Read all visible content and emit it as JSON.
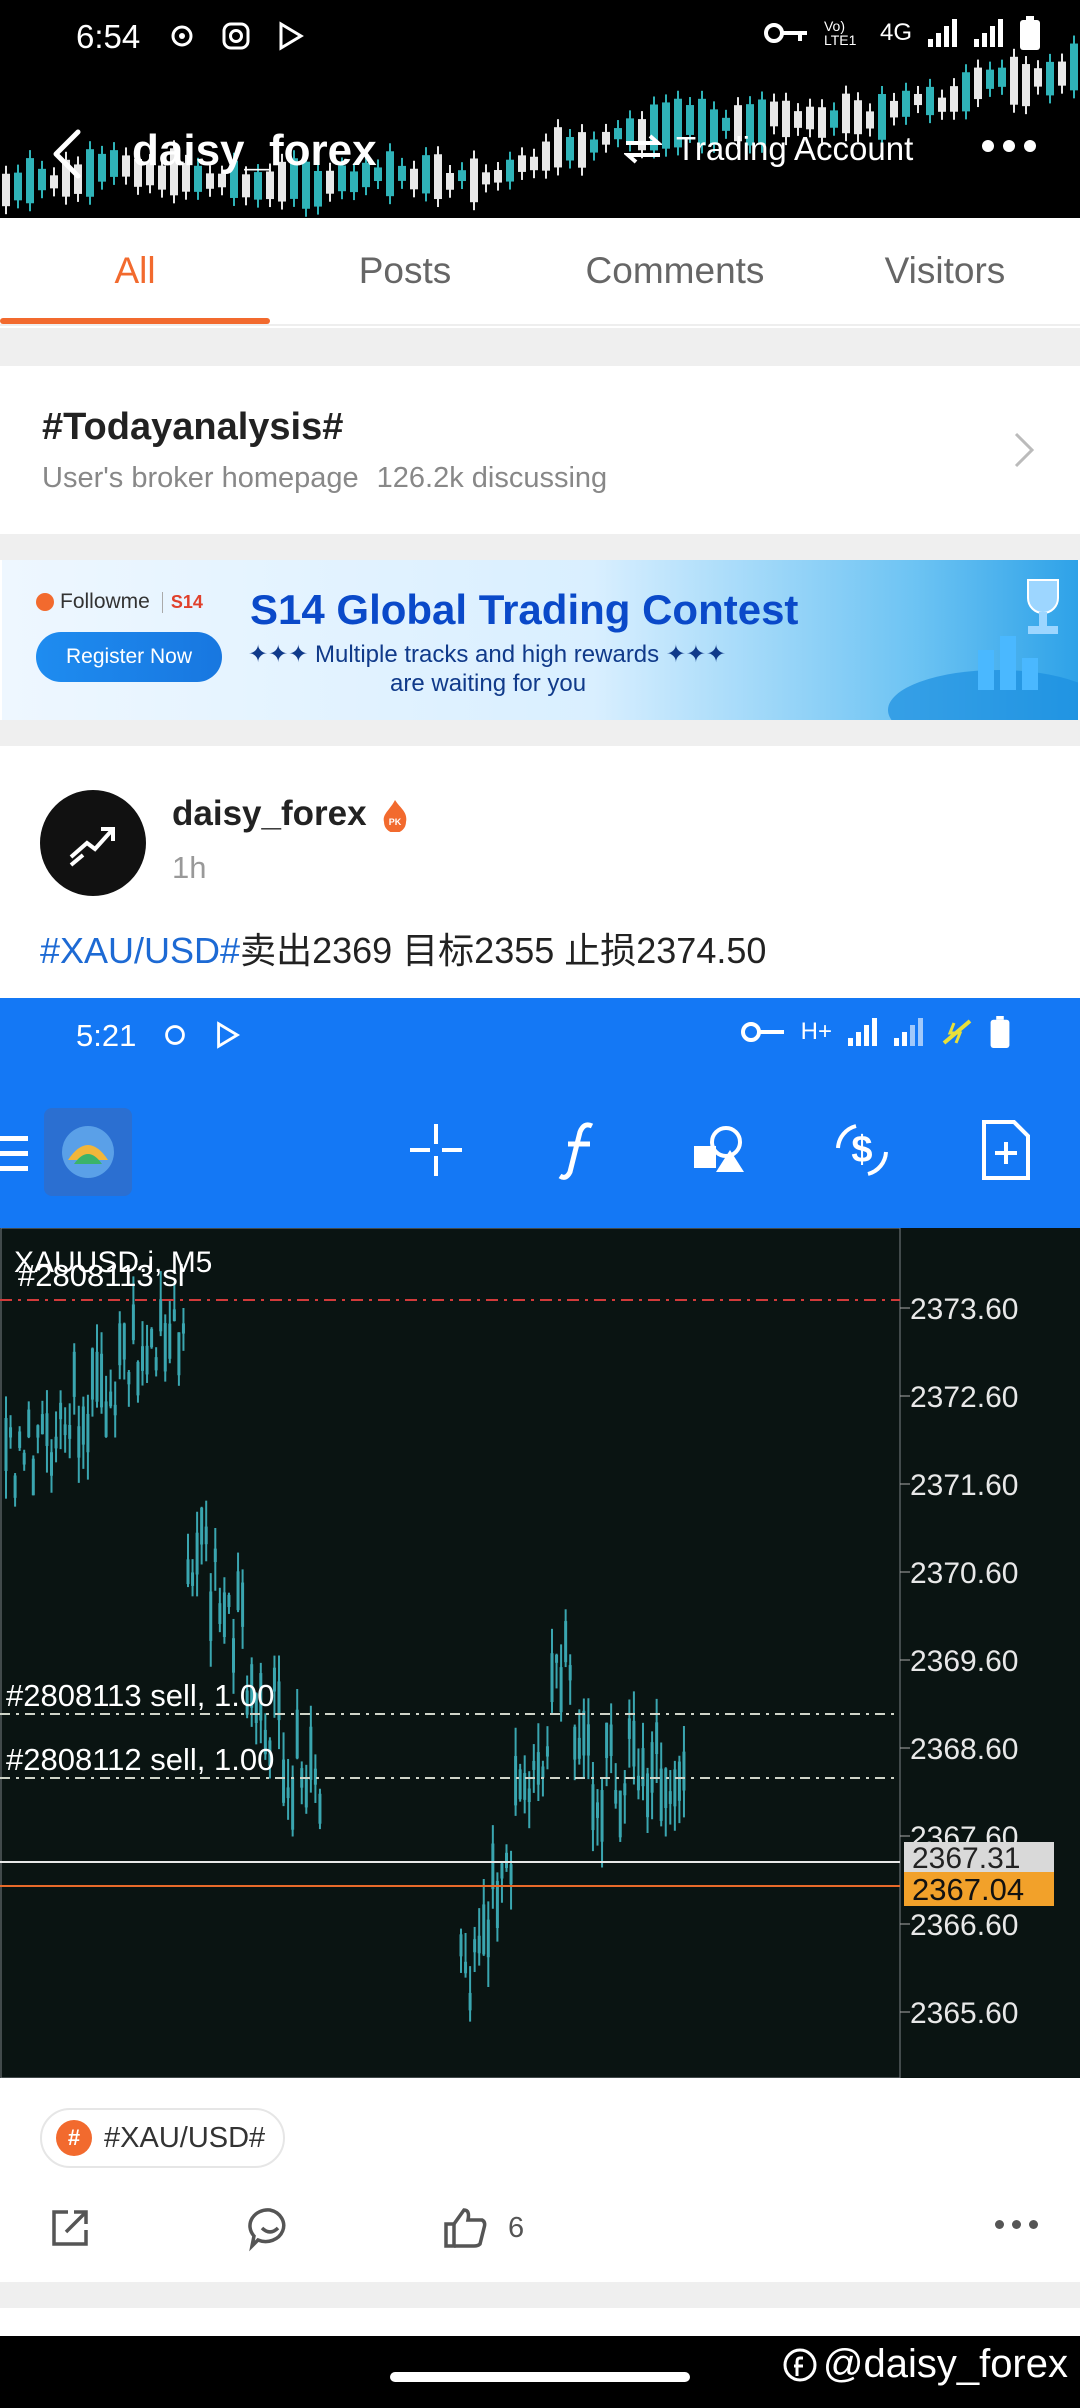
{
  "status_bar": {
    "time": "6:54",
    "network": "4G",
    "lte_label": "Vo) LTE1"
  },
  "nav": {
    "title": "daisy_forex",
    "account_label": "Trading Account"
  },
  "tabs": [
    {
      "label": "All",
      "active": true
    },
    {
      "label": "Posts",
      "active": false
    },
    {
      "label": "Comments",
      "active": false
    },
    {
      "label": "Visitors",
      "active": false
    }
  ],
  "topic": {
    "title": "#Todayanalysis#",
    "subtitle": "User's broker homepage",
    "discussing": "126.2k discussing"
  },
  "banner": {
    "brand": "Followme",
    "brand_tag": "S14",
    "register_label": "Register Now",
    "title": "S14 Global Trading Contest",
    "line1": "Multiple tracks and high rewards",
    "line2": "are waiting for you"
  },
  "post": {
    "author": "daisy_forex",
    "badge": "PK",
    "time": "1h",
    "text_tag": "#XAU/USD#",
    "text_body": "卖出2369 目标2355 止损2374.50",
    "topic_tag": "#XAU/USD#",
    "like_count": "6"
  },
  "embedded": {
    "status_time": "5:21",
    "network": "H+",
    "chart_symbol": "XAUUSD.i, M5",
    "order_sl_label": "#2808113 sl",
    "order1_label": "#2808113 sell, 1.00",
    "order2_label": "#2808112 sell, 1.00",
    "price_labels": [
      "2373.60",
      "2372.60",
      "2371.60",
      "2370.60",
      "2369.60",
      "2368.60",
      "2367.60",
      "2366.60",
      "2365.60"
    ],
    "current_bid": "2367.31",
    "current_price": "2367.04"
  },
  "watermark": "@daisy_forex",
  "colors": {
    "accent": "#f26a2e",
    "link": "#1d6ad4",
    "mt_blue": "#1478f5",
    "candle": "#3aa6b0"
  }
}
